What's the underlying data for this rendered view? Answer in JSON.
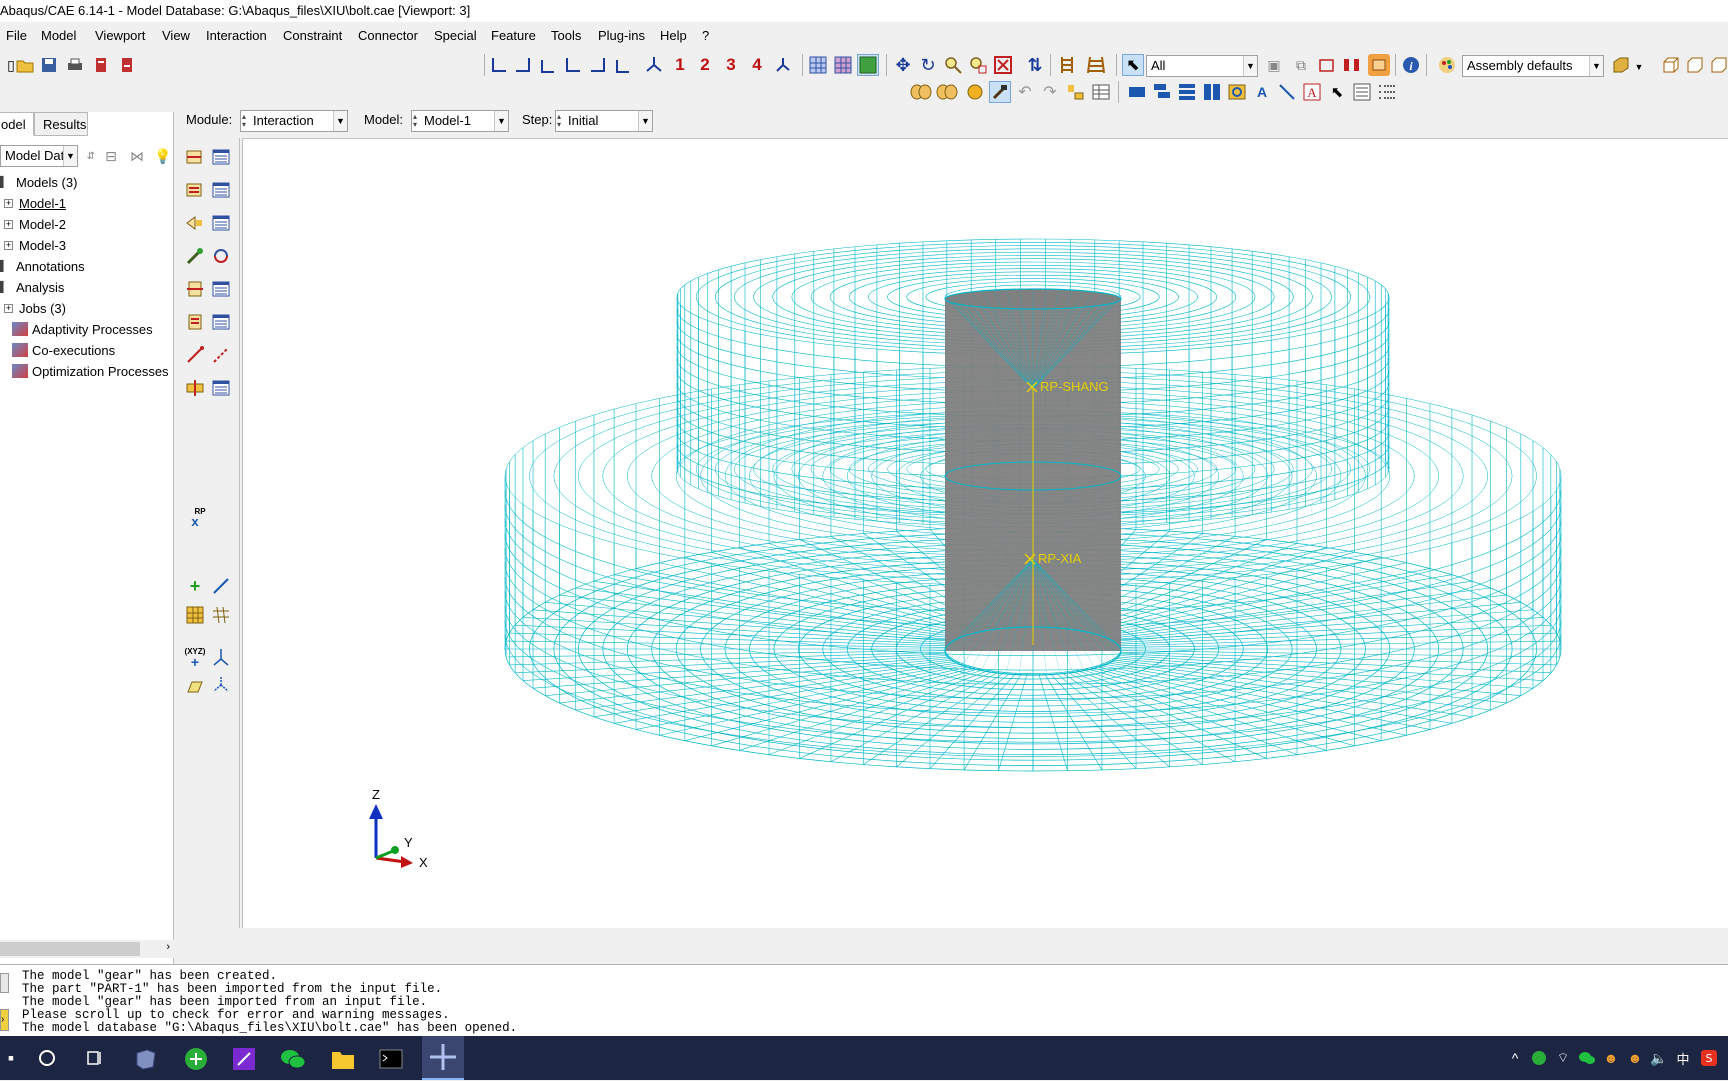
{
  "window": {
    "title": "Abaqus/CAE 6.14-1 - Model Database: G:\\Abaqus_files\\XIU\\bolt.cae [Viewport: 3]"
  },
  "menu": [
    "File",
    "Model",
    "Viewport",
    "View",
    "Interaction",
    "Constraint",
    "Connector",
    "Special",
    "Feature",
    "Tools",
    "Plug-ins",
    "Help",
    "?"
  ],
  "toolbar": {
    "selection_filter": "All",
    "render_style": "Assembly defaults",
    "view_numbers": [
      "1",
      "2",
      "3",
      "4"
    ]
  },
  "context": {
    "module_label": "Module:",
    "module_value": "Interaction",
    "model_label": "Model:",
    "model_value": "Model-1",
    "step_label": "Step:",
    "step_value": "Initial"
  },
  "tabs": [
    "odel",
    "Results"
  ],
  "tree_selector": "Model Dat",
  "tree": [
    {
      "label": "Models (3)",
      "indent": 0,
      "expander": false
    },
    {
      "label": "Model-1",
      "indent": 1,
      "expander": true
    },
    {
      "label": "Model-2",
      "indent": 1,
      "expander": true
    },
    {
      "label": "Model-3",
      "indent": 1,
      "expander": true
    },
    {
      "label": "Annotations",
      "indent": 0,
      "expander": false
    },
    {
      "label": "Analysis",
      "indent": 0,
      "expander": false
    },
    {
      "label": "Jobs (3)",
      "indent": 1,
      "expander": true
    },
    {
      "label": "Adaptivity Processes",
      "indent": 1,
      "expander": false
    },
    {
      "label": "Co-executions",
      "indent": 1,
      "expander": false
    },
    {
      "label": "Optimization Processes",
      "indent": 1,
      "expander": false
    }
  ],
  "viewport": {
    "rp_upper": "RP-SHANG",
    "rp_lower": "RP-XIA",
    "triad": {
      "z": "Z",
      "y": "Y",
      "x": "X"
    },
    "mesh_color": "#00b8c8",
    "rp_color": "#e6d000",
    "bolt_color": "#808080"
  },
  "toolbox_extra": {
    "rp_label": "RP",
    "xyz_label": "(XYZ)"
  },
  "messages": "The model \"gear\" has been created.\nThe part \"PART-1\" has been imported from the input file.\nThe model \"gear\" has been imported from an input file.\nPlease scroll up to check for error and warning messages.\nThe model database \"G:\\Abaqus_files\\XIU\\bolt.cae\" has been opened.",
  "taskbar": {
    "ime": "中"
  }
}
